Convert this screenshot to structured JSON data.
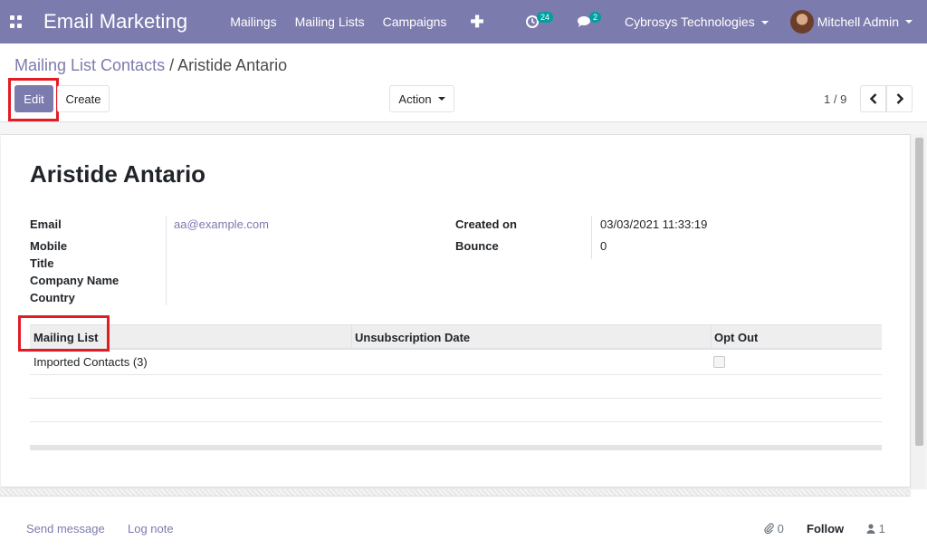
{
  "navbar": {
    "app_name": "Email Marketing",
    "menu": [
      "Mailings",
      "Mailing Lists",
      "Campaigns"
    ],
    "activity_count": "24",
    "message_count": "2",
    "company": "Cybrosys Technologies",
    "user": "Mitchell Admin",
    "bg_color": "#7c7bad"
  },
  "breadcrumb": {
    "parent": "Mailing List Contacts",
    "separator": "/",
    "current": "Aristide Antario"
  },
  "toolbar": {
    "edit_label": "Edit",
    "create_label": "Create",
    "action_label": "Action"
  },
  "pager": {
    "text": "1 / 9"
  },
  "record": {
    "name": "Aristide Antario",
    "fields_left": [
      {
        "label": "Email",
        "value": "aa@example.com"
      },
      {
        "label": "Mobile",
        "value": ""
      },
      {
        "label": "Title",
        "value": ""
      },
      {
        "label": "Company Name",
        "value": ""
      },
      {
        "label": "Country",
        "value": ""
      }
    ],
    "fields_right": [
      {
        "label": "Created on",
        "value": "03/03/2021 11:33:19"
      },
      {
        "label": "Bounce",
        "value": "0"
      }
    ]
  },
  "subscriptions": {
    "columns": [
      "Mailing List",
      "Unsubscription Date",
      "Opt Out"
    ],
    "rows": [
      {
        "mailing_list": "Imported Contacts (3)",
        "unsub_date": "",
        "opt_out": false
      }
    ]
  },
  "chatter": {
    "send_message": "Send message",
    "log_note": "Log note",
    "attachments": "0",
    "follow": "Follow",
    "followers": "1"
  },
  "colors": {
    "highlight": "#e21c25",
    "primary": "#7c7bad"
  }
}
